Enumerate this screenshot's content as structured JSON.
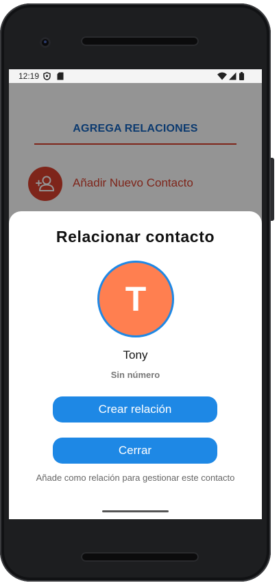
{
  "status_bar": {
    "time": "12:19"
  },
  "background": {
    "section_title": "AGREGA RELACIONES",
    "add_contact_label": "Añadir Nuevo Contacto"
  },
  "dialog": {
    "title": "Relacionar contacto",
    "avatar_letter": "T",
    "contact_name": "Tony",
    "contact_number": "Sin número",
    "create_button": "Crear relación",
    "close_button": "Cerrar",
    "helper_text": "Añade como relación para gestionar este contacto"
  },
  "colors": {
    "accent_blue": "#1e88e5",
    "title_blue": "#1565c0",
    "accent_red": "#d9412e",
    "avatar_orange": "#ff7f50"
  },
  "icons": [
    "shield-icon",
    "sim-card-icon",
    "wifi-icon",
    "cell-signal-icon",
    "battery-icon",
    "add-person-icon"
  ]
}
